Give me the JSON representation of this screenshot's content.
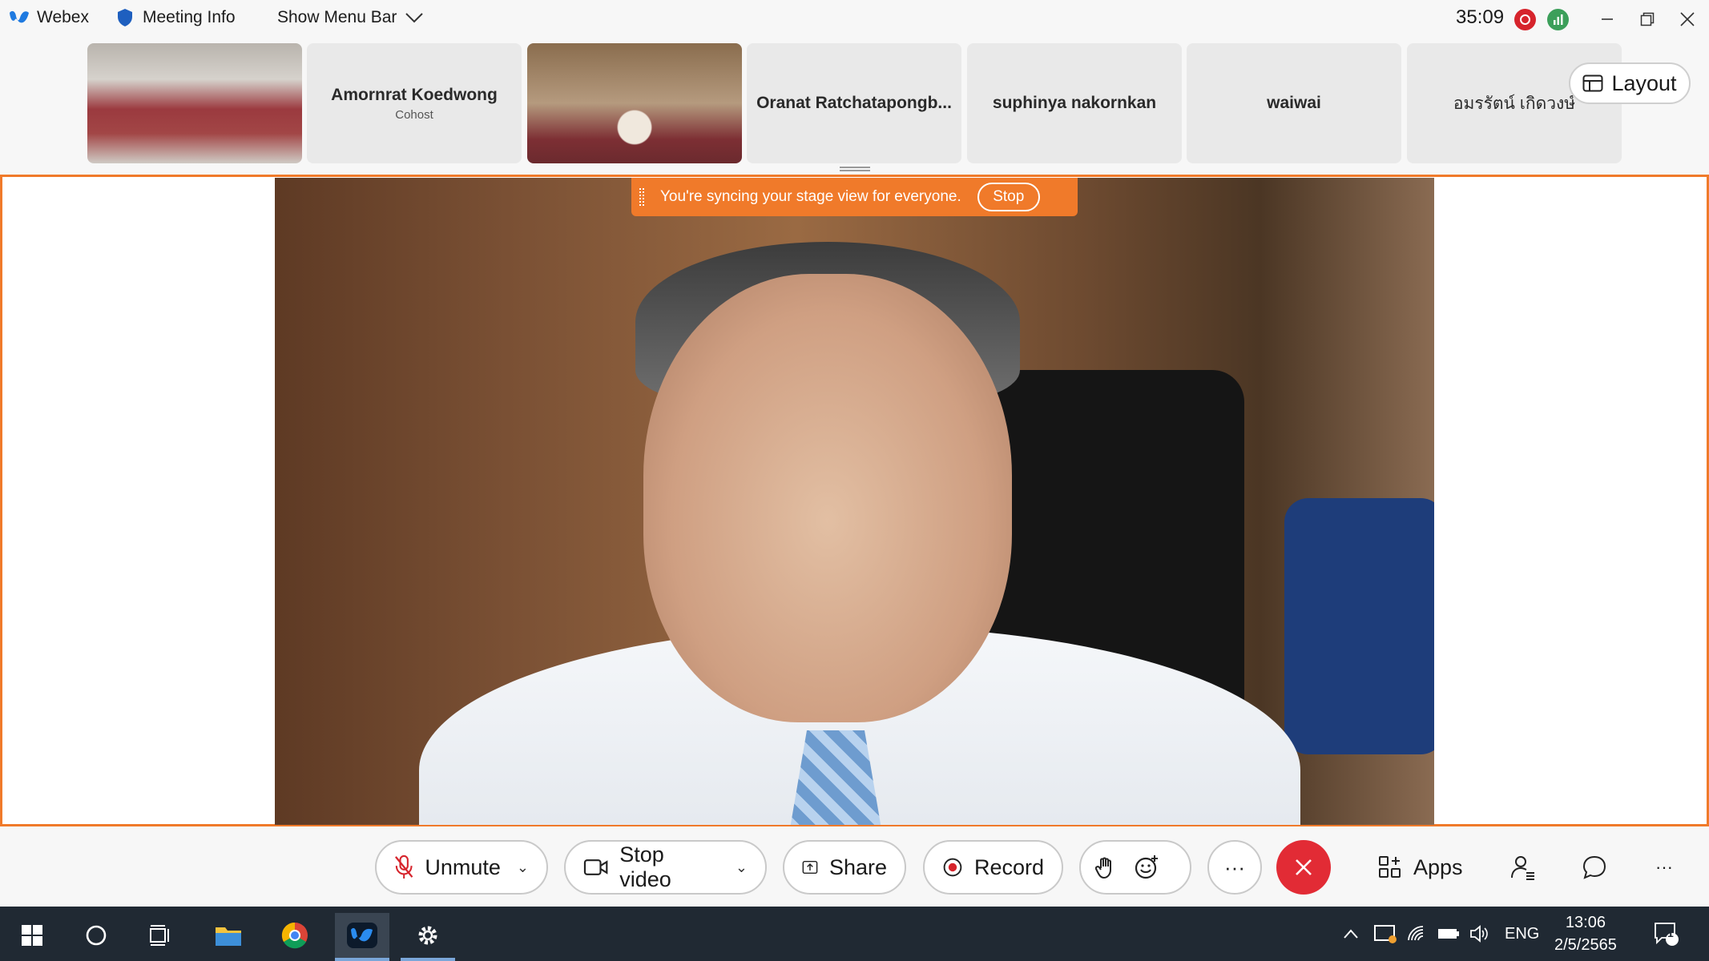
{
  "titlebar": {
    "app_name": "Webex",
    "meeting_info": "Meeting Info",
    "show_menu_bar": "Show Menu Bar",
    "timer": "35:09"
  },
  "filmstrip": {
    "participants": [
      {
        "name": "",
        "role": ""
      },
      {
        "name": "Amornrat Koedwong",
        "role": "Cohost"
      },
      {
        "name": "",
        "role": ""
      },
      {
        "name": "Oranat Ratchatapongb...",
        "role": ""
      },
      {
        "name": "suphinya nakornkan",
        "role": ""
      },
      {
        "name": "waiwai",
        "role": ""
      },
      {
        "name": "อมรรัตน์ เกิดวงษ์",
        "role": ""
      }
    ],
    "layout_label": "Layout"
  },
  "stage": {
    "sync_message": "You're syncing your stage view for everyone.",
    "stop_label": "Stop"
  },
  "controls": {
    "unmute": "Unmute",
    "stop_video": "Stop video",
    "share": "Share",
    "record": "Record",
    "more": "···",
    "apps": "Apps",
    "overflow": "···"
  },
  "taskbar": {
    "language": "ENG",
    "time": "13:06",
    "date": "2/5/2565",
    "notification_count": "1"
  },
  "colors": {
    "accent": "#f07a2a",
    "end_call": "#e22b35",
    "recording": "#d6242c",
    "network": "#3c9f5a",
    "taskbar": "#202933"
  }
}
